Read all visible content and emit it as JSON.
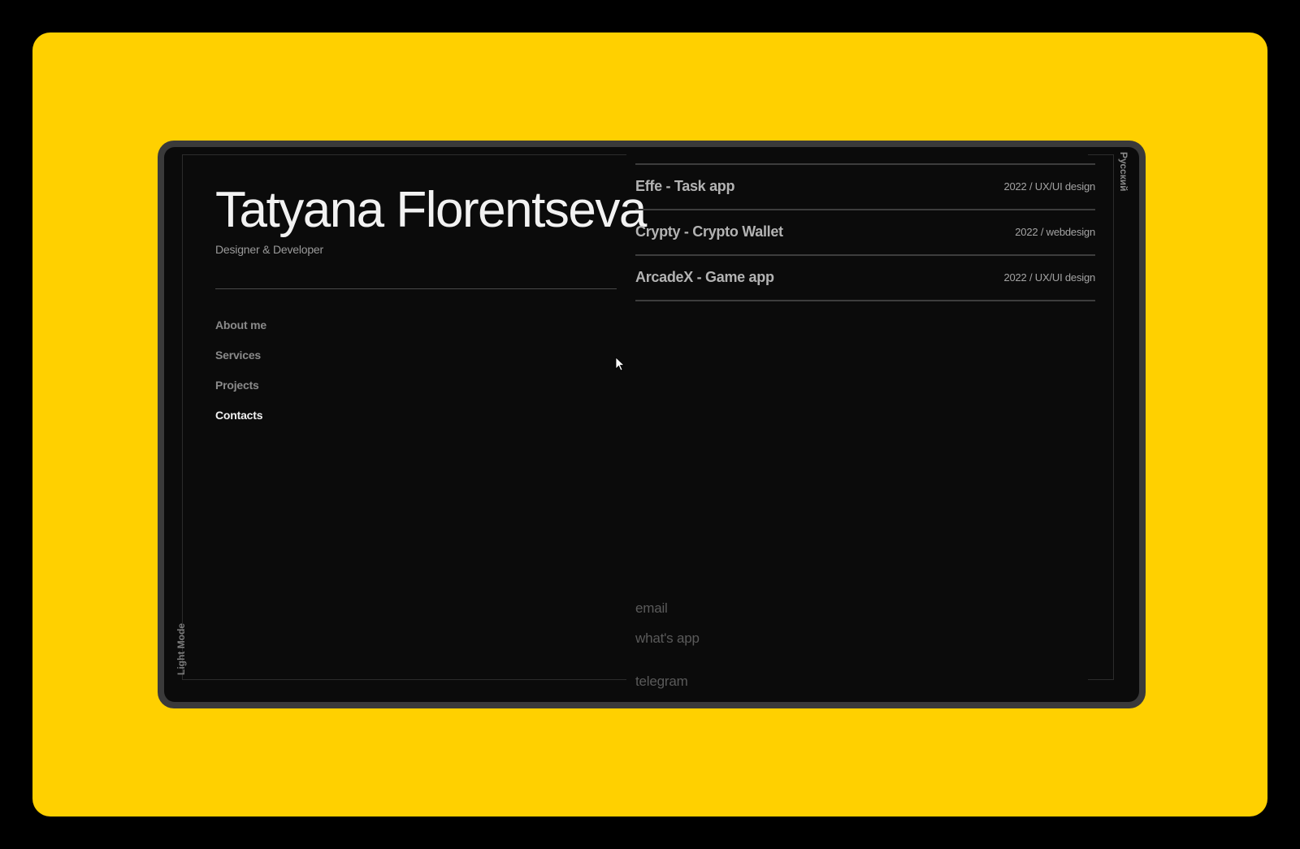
{
  "hero": {
    "name": "Tatyana Florentseva",
    "role": "Designer & Developer"
  },
  "nav": {
    "items": [
      {
        "label": "About me"
      },
      {
        "label": "Services"
      },
      {
        "label": "Projects"
      },
      {
        "label": "Contacts",
        "active": true
      }
    ]
  },
  "projects": [
    {
      "title": "Effe - Task app",
      "meta": "2022 / UX/UI design"
    },
    {
      "title": "Crypty - Crypto Wallet",
      "meta": "2022 / webdesign"
    },
    {
      "title": "ArcadeX - Game app",
      "meta": "2022 / UX/UI design"
    }
  ],
  "contacts": {
    "email": "email",
    "whatsapp": "what's app",
    "telegram": "telegram"
  },
  "toggles": {
    "theme": "Light Mode",
    "language": "Русский"
  },
  "colors": {
    "background": "#FFD000",
    "screen": "#0b0b0b",
    "text_primary": "#f2f2f2",
    "text_muted": "#8a8a8a"
  }
}
